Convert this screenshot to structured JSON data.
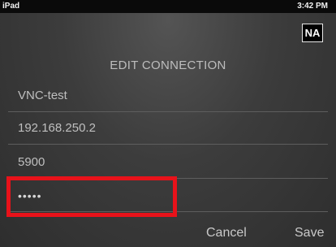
{
  "status_bar": {
    "device": "iPad",
    "time": "3:42 PM"
  },
  "badge": {
    "label": "NA"
  },
  "title": "EDIT CONNECTION",
  "fields": {
    "name": {
      "value": "VNC-test"
    },
    "host": {
      "value": "192.168.250.2"
    },
    "port": {
      "value": "5900"
    },
    "password": {
      "value": "•••••"
    }
  },
  "actions": {
    "cancel_label": "Cancel",
    "save_label": "Save"
  },
  "colors": {
    "highlight": "#e8121a",
    "background": "#3c3c3c",
    "status_bar": "#0a0a0a"
  }
}
